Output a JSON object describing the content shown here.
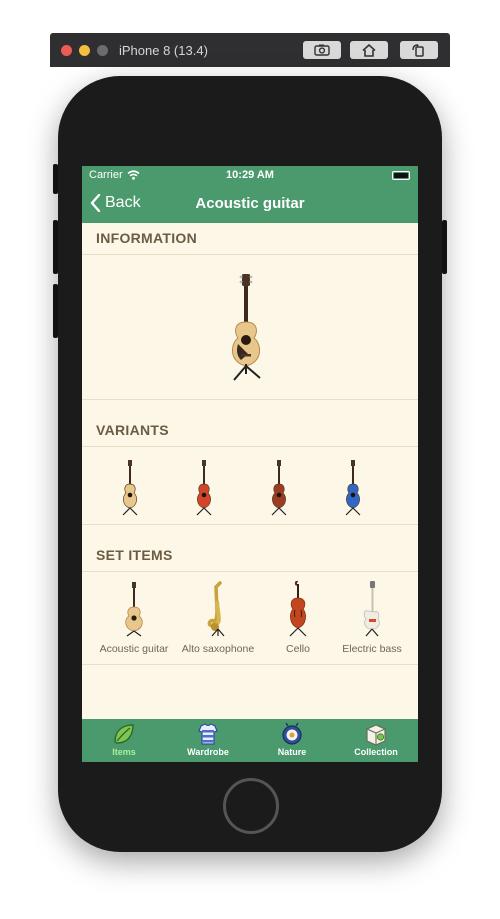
{
  "simulator": {
    "title": "iPhone 8 (13.4)"
  },
  "status_bar": {
    "carrier": "Carrier",
    "time": "10:29 AM"
  },
  "nav": {
    "back_label": "Back",
    "title": "Acoustic guitar"
  },
  "sections": {
    "information": "INFORMATION",
    "variants": "VARIANTS",
    "set_items": "SET ITEMS"
  },
  "variants": [
    {
      "color": "natural",
      "body": "#e8c78c"
    },
    {
      "color": "red-sunburst",
      "body": "#d2452a"
    },
    {
      "color": "brown-sunburst",
      "body": "#9a3d22"
    },
    {
      "color": "blue",
      "body": "#2f67c8"
    }
  ],
  "set_items": [
    {
      "label": "Acoustic guitar",
      "icon": "acoustic-guitar-icon"
    },
    {
      "label": "Alto saxophone",
      "icon": "alto-saxophone-icon"
    },
    {
      "label": "Cello",
      "icon": "cello-icon"
    },
    {
      "label": "Electric bass",
      "icon": "electric-bass-icon"
    }
  ],
  "tabs": [
    {
      "label": "Items",
      "icon": "leaf-icon",
      "active": true
    },
    {
      "label": "Wardrobe",
      "icon": "shirt-icon",
      "active": false
    },
    {
      "label": "Nature",
      "icon": "bug-icon",
      "active": false
    },
    {
      "label": "Collection",
      "icon": "box-icon",
      "active": false
    }
  ],
  "colors": {
    "accent": "#4a9a6d",
    "background": "#fcf7e7",
    "active_tab": "#a9ee9a"
  }
}
